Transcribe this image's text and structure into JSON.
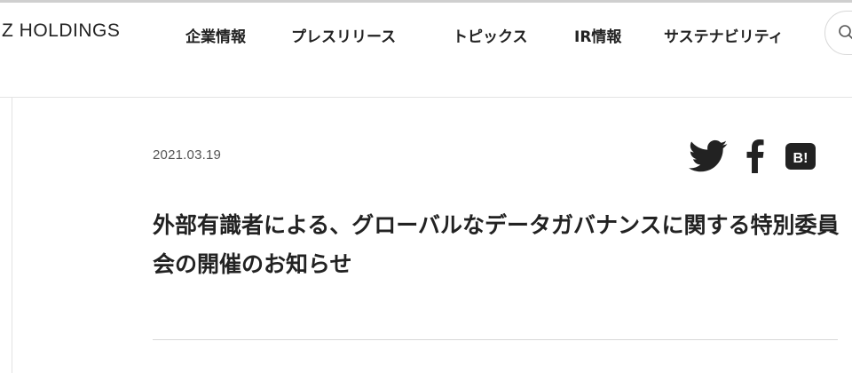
{
  "header": {
    "logo": "Z HOLDINGS",
    "nav": [
      {
        "label": "企業情報"
      },
      {
        "label": "プレスリリース"
      },
      {
        "label": "トピックス"
      },
      {
        "label": "IR情報"
      },
      {
        "label": "サステナビリティ"
      }
    ],
    "search_icon": "search-icon"
  },
  "article": {
    "date": "2021.03.19",
    "title": "外部有識者による、グローバルなデータガバナンスに関する特別委員会の開催のお知らせ",
    "share": [
      {
        "icon": "twitter-icon"
      },
      {
        "icon": "facebook-icon"
      },
      {
        "icon": "hatena-bookmark-icon",
        "label": "B!"
      }
    ]
  },
  "colors": {
    "text": "#222222",
    "rule": "#e3e3e3",
    "date": "#555555"
  }
}
